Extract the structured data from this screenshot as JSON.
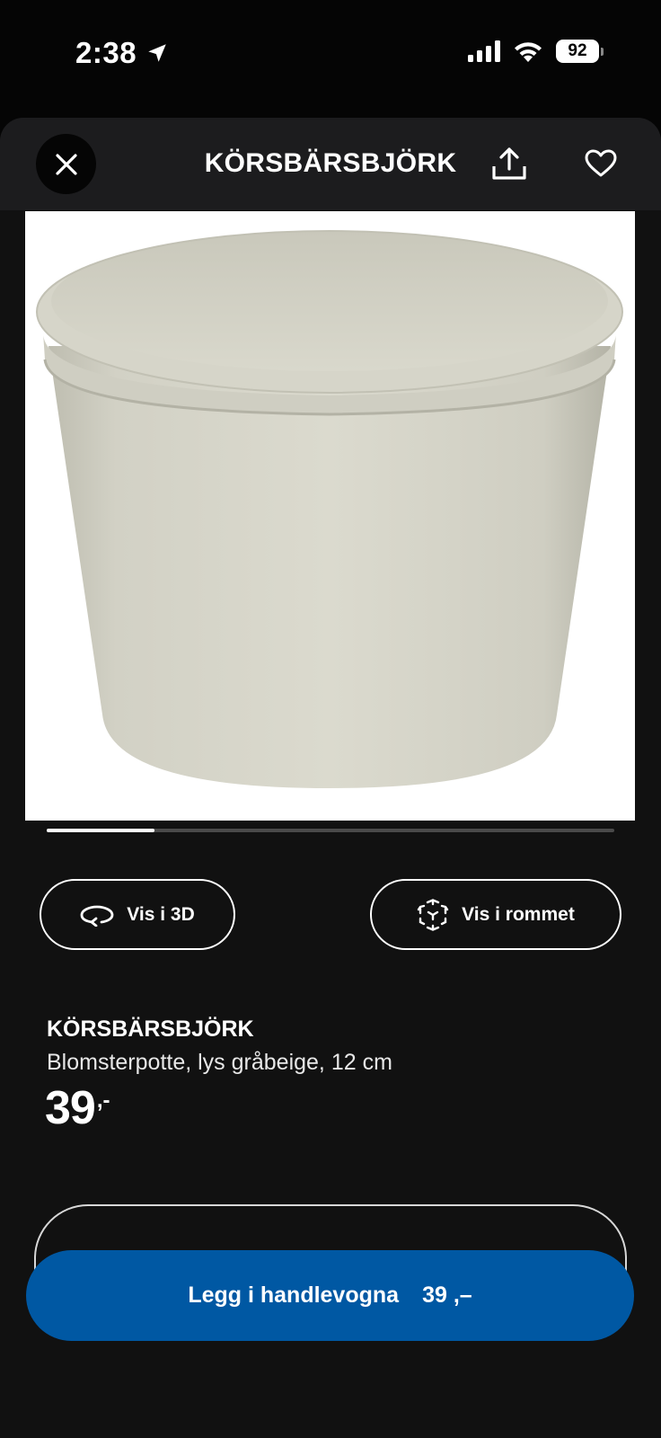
{
  "status_bar": {
    "time": "2:38",
    "battery": "92",
    "location_icon": "location-arrow-icon",
    "signal_icon": "cellular-signal-icon",
    "wifi_icon": "wifi-icon"
  },
  "header": {
    "title": "KÖRSBÄRSBJÖRK",
    "close_icon": "close-icon",
    "share_icon": "share-icon",
    "favorite_icon": "heart-icon"
  },
  "gallery": {
    "image_alt": "product-image",
    "progress": 0.19
  },
  "actions": {
    "view_3d_label": "Vis i 3D",
    "view_3d_icon": "rotate-3d-icon",
    "view_room_label": "Vis i rommet",
    "view_room_icon": "ar-cube-icon"
  },
  "product": {
    "name": "KÖRSBÄRSBJÖRK",
    "description": "Blomsterpotte, lys gråbeige, 12 cm",
    "price": "39",
    "price_suffix": ",-"
  },
  "cart": {
    "label": "Legg i handlevogna",
    "price": "39 ,–"
  },
  "colors": {
    "background": "#050505",
    "sheet": "#111111",
    "accent_blue": "#0058a3",
    "pot": "#d6d5c8"
  }
}
